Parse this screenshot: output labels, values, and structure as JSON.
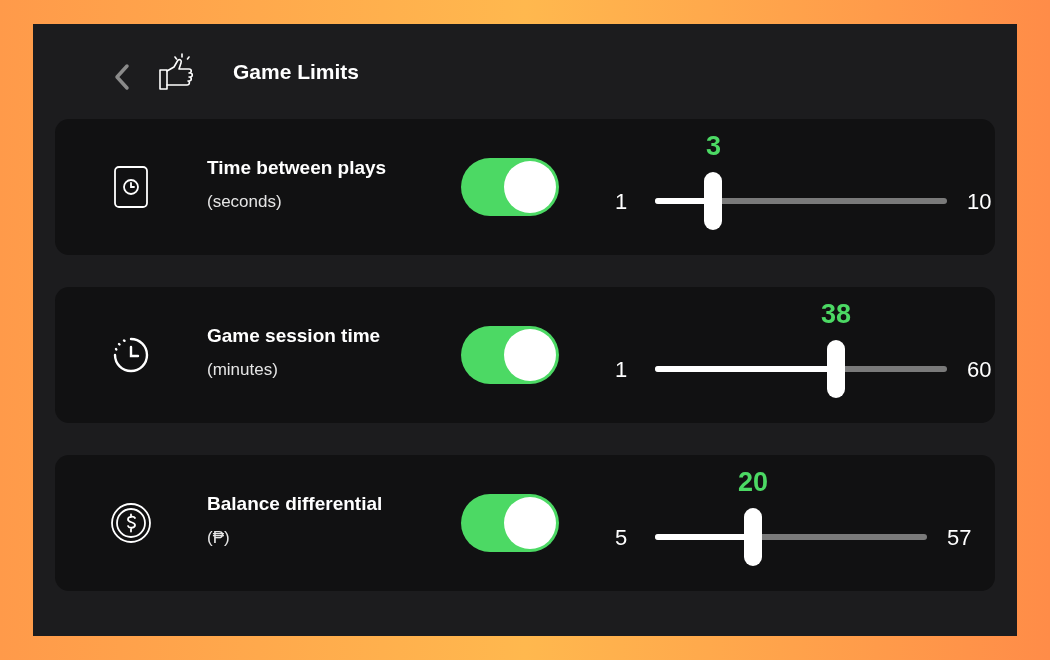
{
  "header": {
    "title": "Game Limits"
  },
  "limits": [
    {
      "kind": "timer",
      "title": "Time between plays",
      "unit": "(seconds)",
      "on": true,
      "min": "1",
      "max": "10",
      "value": "3",
      "level": 0.2
    },
    {
      "kind": "session",
      "title": "Game session time",
      "unit": "(minutes)",
      "on": true,
      "min": "1",
      "max": "60",
      "value": "38",
      "level": 0.62
    },
    {
      "kind": "money",
      "title": "Balance differential",
      "unit": "(₱)",
      "on": true,
      "min": "5",
      "max": "57",
      "value": "20",
      "level": 0.36
    }
  ]
}
